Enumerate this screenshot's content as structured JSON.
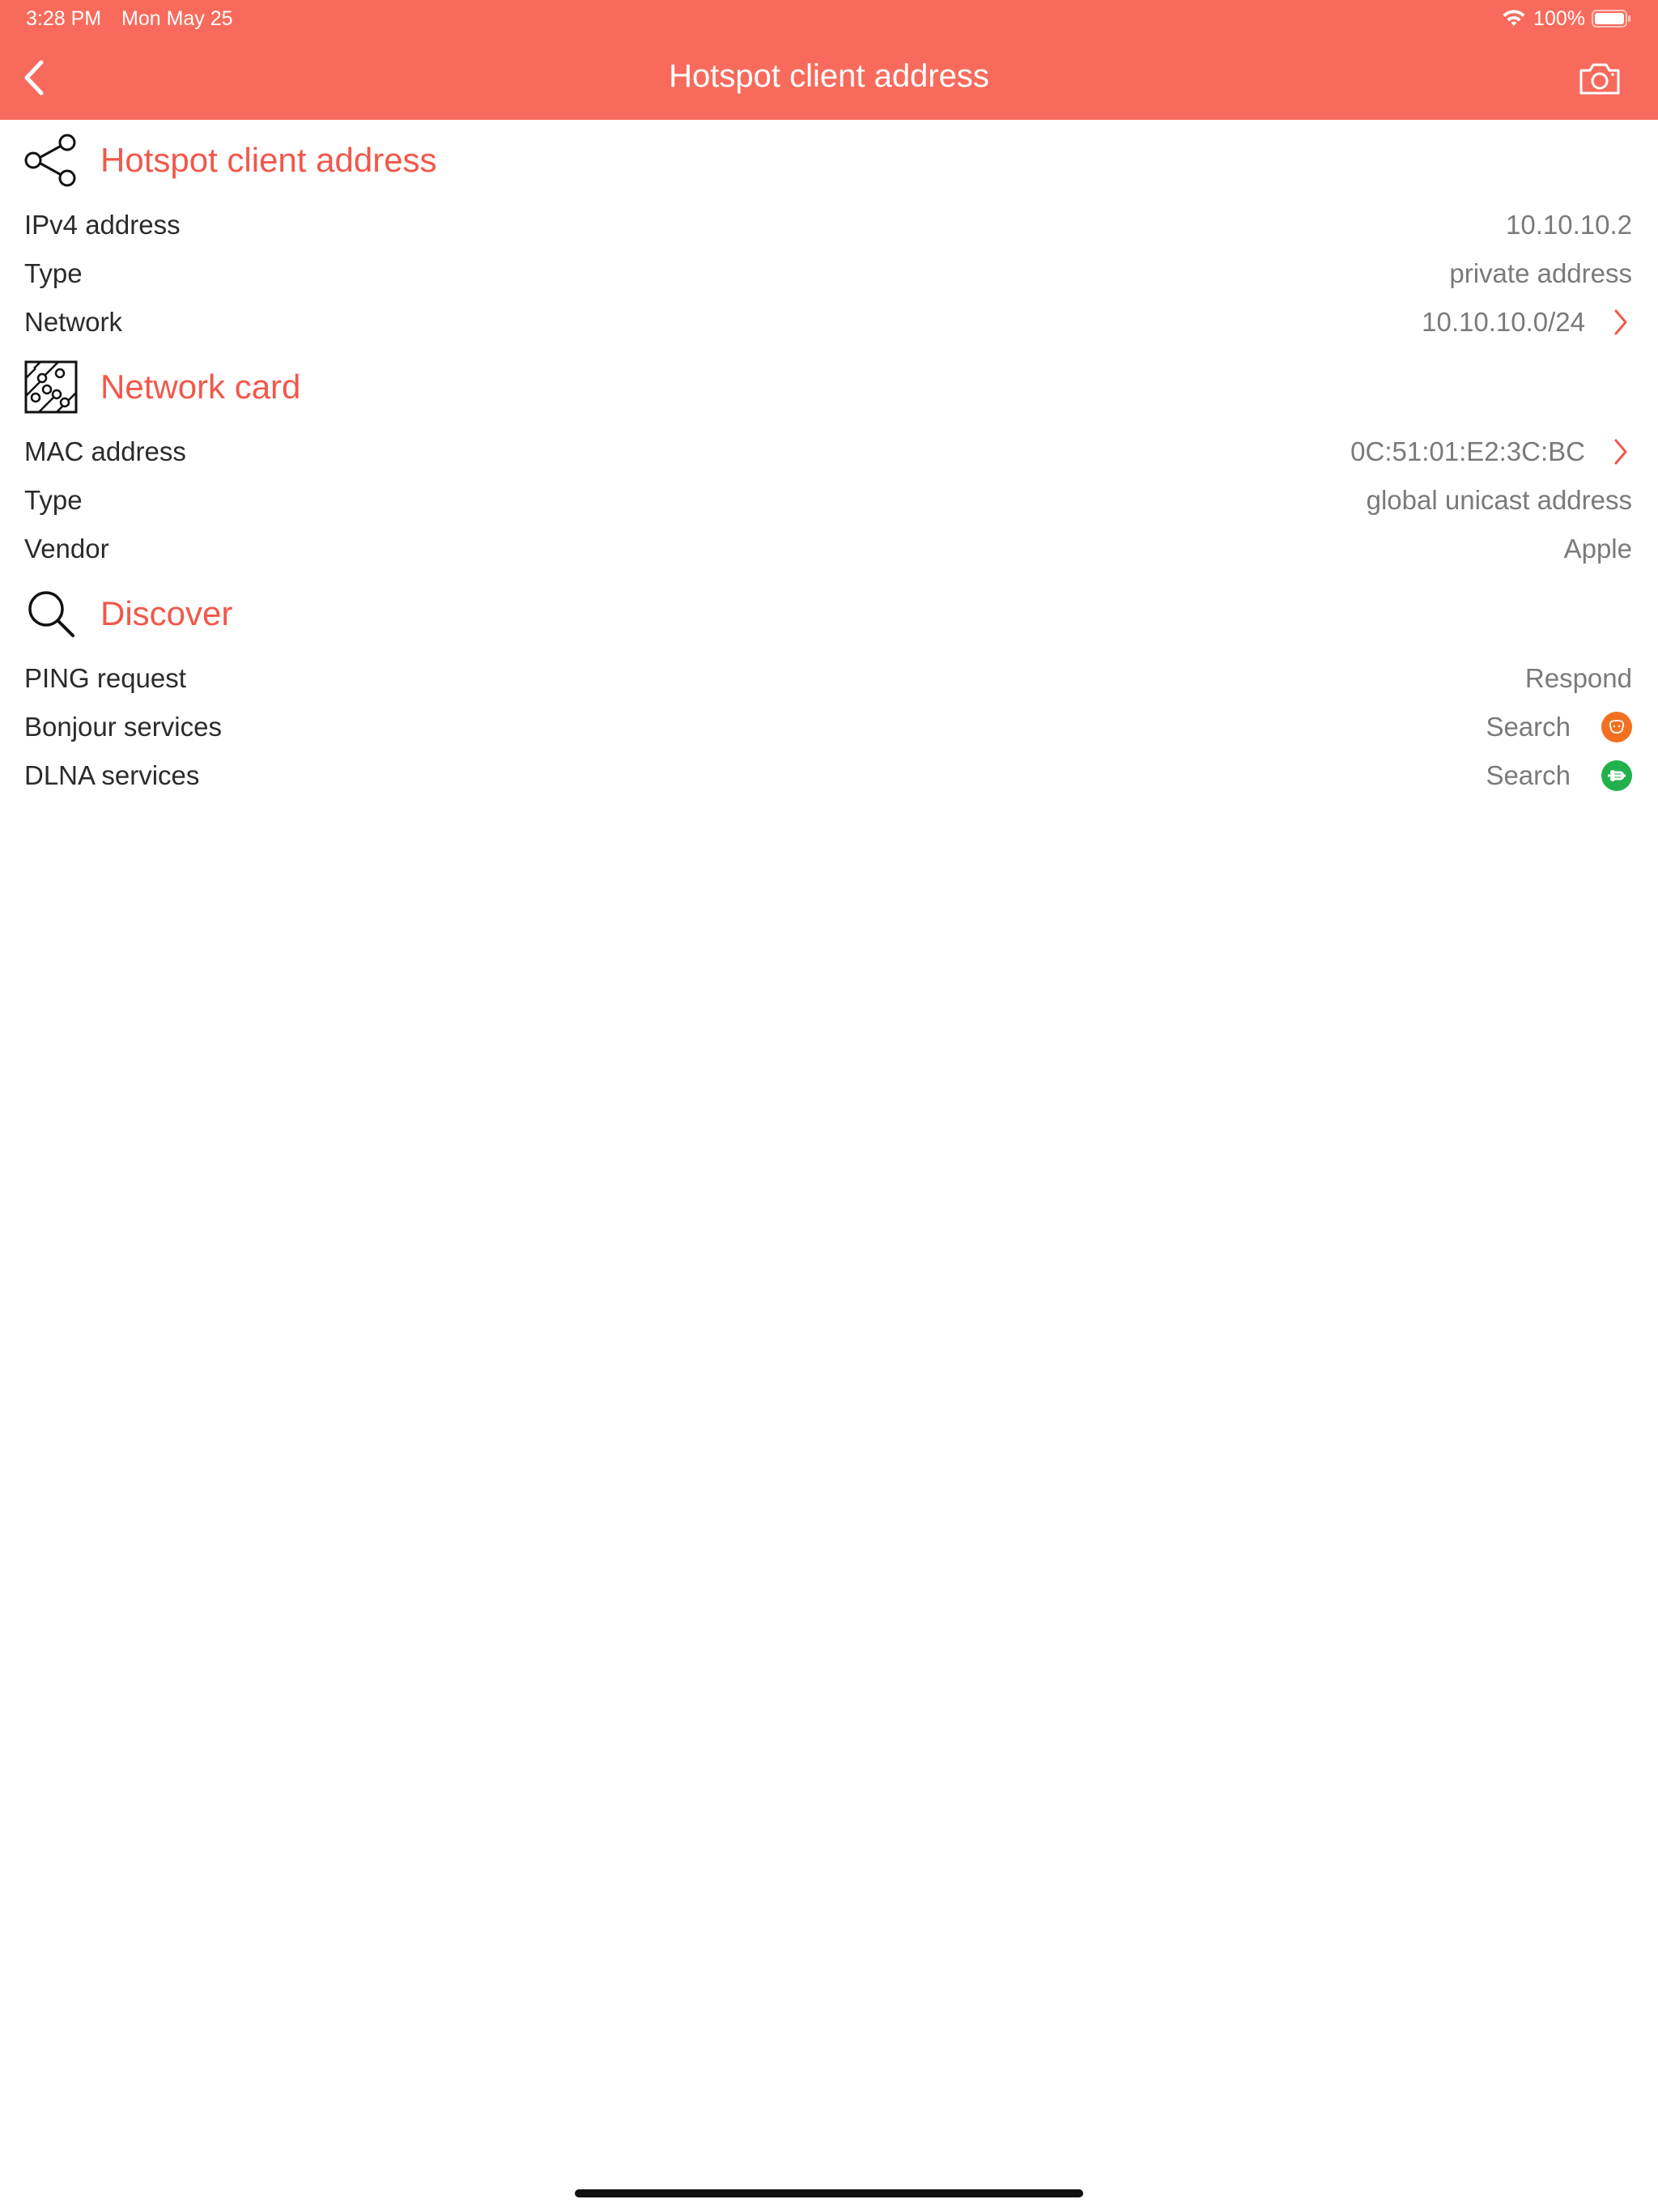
{
  "status": {
    "time": "3:28 PM",
    "date": "Mon May 25",
    "battery": "100%"
  },
  "nav": {
    "title": "Hotspot client address",
    "back_icon": "chevron-left-icon",
    "camera_icon": "camera-icon"
  },
  "colors": {
    "accent": "#F86B5C",
    "section_title": "#F1584A",
    "bonjour": "#F2701F",
    "dlna": "#22B14C"
  },
  "sections": {
    "client": {
      "title": "Hotspot client address",
      "icon": "share-nodes-icon",
      "rows": [
        {
          "label": "IPv4 address",
          "value": "10.10.10.2"
        },
        {
          "label": "Type",
          "value": "private address"
        },
        {
          "label": "Network",
          "value": "10.10.10.0/24"
        }
      ]
    },
    "card": {
      "title": "Network card",
      "icon": "circuit-board-icon",
      "rows": [
        {
          "label": "MAC address",
          "value": "0C:51:01:E2:3C:BC"
        },
        {
          "label": "Type",
          "value": "global unicast address"
        },
        {
          "label": "Vendor",
          "value": "Apple"
        }
      ]
    },
    "discover": {
      "title": "Discover",
      "icon": "search-icon",
      "rows": [
        {
          "label": "PING request",
          "value": "Respond"
        },
        {
          "label": "Bonjour services",
          "value": "Search",
          "icon": "bonjour-icon"
        },
        {
          "label": "DLNA services",
          "value": "Search",
          "icon": "dlna-icon"
        }
      ]
    }
  }
}
